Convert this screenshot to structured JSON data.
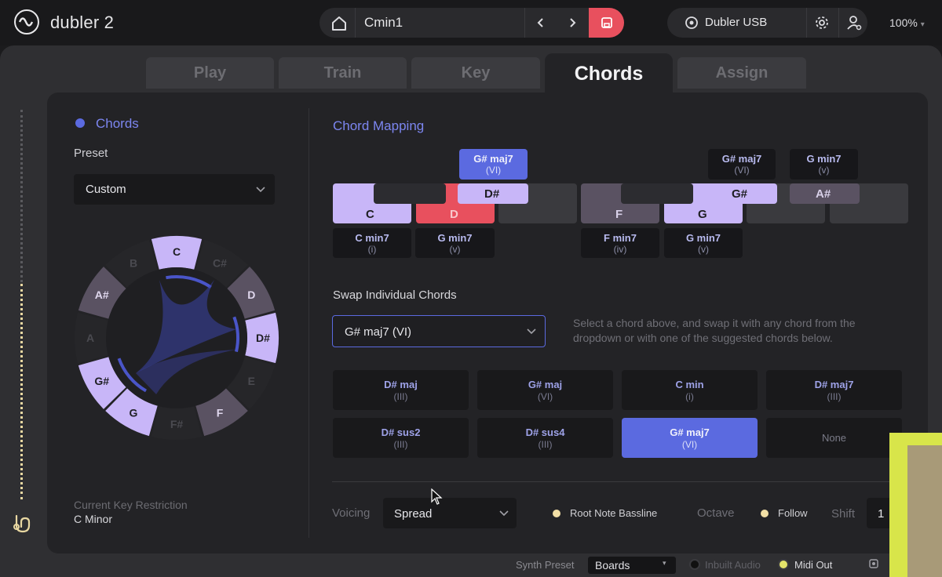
{
  "app": {
    "name": "dubler 2"
  },
  "topbar": {
    "preset_name": "Cmin1",
    "device_name": "Dubler USB",
    "zoom": "100%",
    "prev_icon": "chevron-left-icon",
    "next_icon": "chevron-right-icon",
    "save_color": "#e8505e"
  },
  "tabs": [
    {
      "label": "Play",
      "active": false
    },
    {
      "label": "Train",
      "active": false
    },
    {
      "label": "Key",
      "active": false
    },
    {
      "label": "Chords",
      "active": true
    },
    {
      "label": "Assign",
      "active": false
    }
  ],
  "left": {
    "title": "Chords",
    "preset_label": "Preset",
    "preset_value": "Custom",
    "circle_notes": [
      "C",
      "C#",
      "D",
      "D#",
      "E",
      "F",
      "F#",
      "G",
      "G#",
      "A",
      "A#",
      "B"
    ],
    "key_restriction_label": "Current Key Restriction",
    "key_restriction_value": "C Minor"
  },
  "mapping": {
    "title": "Chord Mapping",
    "keys": {
      "c": "C",
      "d": "D",
      "ds": "D#",
      "f": "F",
      "g": "G",
      "gs": "G#",
      "as": "A#"
    },
    "cards": {
      "c": {
        "name": "C min7",
        "roman": "(i)"
      },
      "d": {
        "name": "G min7",
        "roman": "(v)"
      },
      "ds": {
        "name": "G# maj7",
        "roman": "(VI)"
      },
      "f": {
        "name": "F min7",
        "roman": "(iv)"
      },
      "g": {
        "name": "G min7",
        "roman": "(v)"
      },
      "gs": {
        "name": "G# maj7",
        "roman": "(VI)"
      },
      "as": {
        "name": "G min7",
        "roman": "(v)"
      }
    }
  },
  "swap": {
    "label": "Swap Individual Chords",
    "selected": "G# maj7 (VI)",
    "help": "Select a chord above, and swap it with any chord from the dropdown or with one of the suggested chords below.",
    "options": [
      {
        "name": "D# maj",
        "roman": "(III)",
        "selected": false
      },
      {
        "name": "G# maj",
        "roman": "(VI)",
        "selected": false
      },
      {
        "name": "C min",
        "roman": "(i)",
        "selected": false
      },
      {
        "name": "D# maj7",
        "roman": "(III)",
        "selected": false
      },
      {
        "name": "D# sus2",
        "roman": "(III)",
        "selected": false
      },
      {
        "name": "D# sus4",
        "roman": "(III)",
        "selected": false
      },
      {
        "name": "G# maj7",
        "roman": "(VI)",
        "selected": true
      },
      {
        "name": "None",
        "roman": "",
        "selected": false
      }
    ]
  },
  "bottom": {
    "voicing_label": "Voicing",
    "voicing_value": "Spread",
    "root_bassline": "Root Note Bassline",
    "octave_label": "Octave",
    "follow": "Follow",
    "shift_label": "Shift",
    "shift_value": "1"
  },
  "status": {
    "synth_preset_label": "Synth Preset",
    "synth_preset_value": "Boards",
    "inbuilt_audio": "Inbuilt Audio",
    "midi_out": "Midi Out"
  },
  "colors": {
    "accent": "#5b6ae0",
    "lavender": "#c8b6f8",
    "red": "#e8505e",
    "dim_key": "#5a5262"
  }
}
